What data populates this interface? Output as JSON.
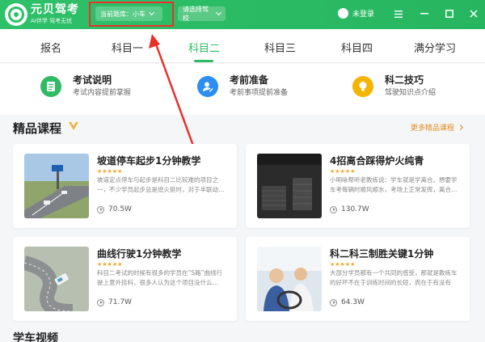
{
  "app": {
    "name": "元贝驾考",
    "tagline": "AI伴学 驾考无忧",
    "brand_color": "#2fc06a",
    "accent_color": "#e88a1a"
  },
  "header": {
    "question_bank_label": "当前题库：小车",
    "school_select_label": "请选择驾校",
    "user_status": "未登录",
    "menu_icon": "menu-icon",
    "minimize_icon": "minimize-icon",
    "maximize_icon": "maximize-icon",
    "close_icon": "close-icon"
  },
  "nav": {
    "tabs": [
      {
        "label": "报名"
      },
      {
        "label": "科目一"
      },
      {
        "label": "科目二",
        "active": true
      },
      {
        "label": "科目三"
      },
      {
        "label": "科目四"
      },
      {
        "label": "满分学习"
      }
    ]
  },
  "features": [
    {
      "title": "考试说明",
      "subtitle": "考试内容提前掌握",
      "icon": "document-icon",
      "color": "#2fba63"
    },
    {
      "title": "考前准备",
      "subtitle": "考前事项提前准备",
      "icon": "user-edit-icon",
      "color": "#2b8ef0"
    },
    {
      "title": "科二技巧",
      "subtitle": "驾驶知识点介绍",
      "icon": "lightbulb-icon",
      "color": "#f5b400"
    }
  ],
  "courses": {
    "section_title": "精品课程",
    "more_label": "更多精品课程",
    "items": [
      {
        "title": "坡道停车起步1分钟教学",
        "stars": "★★★★★",
        "desc": "坡道定点停车与起步是科目二比较难的项目之一，不少学员起步总是熄火挺时，对于半联动…",
        "views": "70.5W"
      },
      {
        "title": "4招离合踩得炉火纯青",
        "stars": "★★★★★",
        "desc": "小明咏帮听老教练说：学车就是学离合。想要学车考每辆时顺风顺水，考场上正常发挥，离合…",
        "views": "130.7W"
      },
      {
        "title": "曲线行驶1分钟教学",
        "stars": "★★★★★",
        "desc": "科目二考试的时候有很多的学员在“S路”曲线行驶上意外挂科，很多人认为这个项目没什么…",
        "views": "71.7W"
      },
      {
        "title": "科二科三制胜关键1分钟",
        "stars": "★★★★★",
        "desc": "大部分学员都有一个共同的感受，那就是教练车的好坏不在于训练时间的长短，而在于有没有把…",
        "views": "64.3W"
      }
    ]
  },
  "bottom_section_title": "学车视频"
}
